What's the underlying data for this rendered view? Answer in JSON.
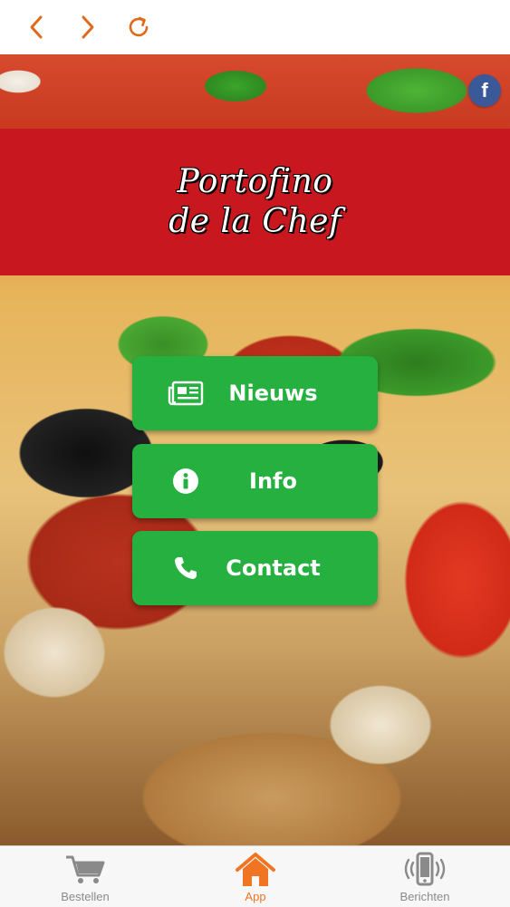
{
  "topbar": {
    "back_icon": "chevron-left-icon",
    "forward_icon": "chevron-right-icon",
    "reload_icon": "reload-icon",
    "accent_color": "#e06a1b"
  },
  "facebook": {
    "glyph": "f",
    "color": "#3b5998"
  },
  "banner": {
    "title_line1": "Portofino",
    "title_line2": "de la Chef",
    "background": "#c8171e"
  },
  "menu": [
    {
      "label": "Nieuws",
      "icon": "newspaper-icon"
    },
    {
      "label": "Info",
      "icon": "info-icon"
    },
    {
      "label": "Contact",
      "icon": "phone-icon"
    }
  ],
  "menu_color": "#25b040",
  "tabbar": {
    "items": [
      {
        "label": "Bestellen",
        "icon": "cart-icon",
        "active": false
      },
      {
        "label": "App",
        "icon": "home-icon",
        "active": true
      },
      {
        "label": "Berichten",
        "icon": "mobile-notification-icon",
        "active": false
      }
    ],
    "active_color": "#f07522",
    "inactive_color": "#8a8a8a"
  }
}
